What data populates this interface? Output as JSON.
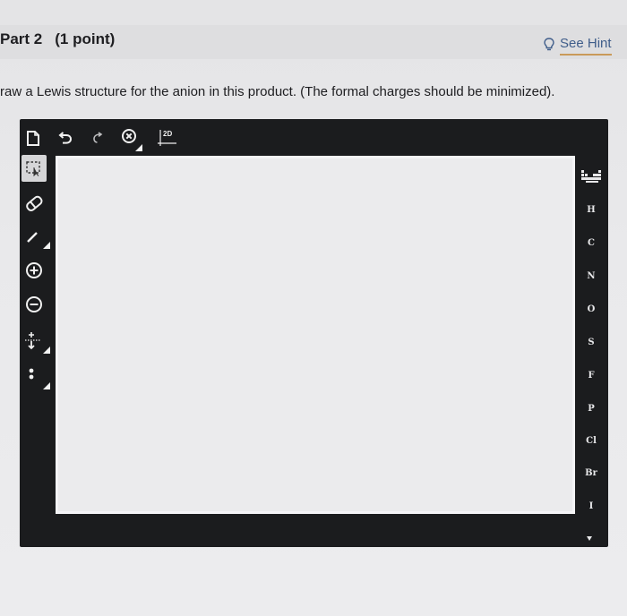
{
  "header": {
    "part_label": "Part 2",
    "points_label": "(1 point)",
    "hint_label": "See Hint"
  },
  "prompt": "raw a Lewis structure for the anion in this product. (The formal charges should be minimized).",
  "toolbar": {
    "top": [
      {
        "name": "new-document-icon"
      },
      {
        "name": "undo-icon"
      },
      {
        "name": "redo-icon"
      },
      {
        "name": "clear-icon"
      },
      {
        "name": "view-2d-button",
        "label": "2D"
      }
    ],
    "left": [
      {
        "name": "select-tool"
      },
      {
        "name": "eraser-tool"
      },
      {
        "name": "bond-tool"
      },
      {
        "name": "positive-charge-tool"
      },
      {
        "name": "negative-charge-tool"
      },
      {
        "name": "arrow-tool"
      },
      {
        "name": "lone-pair-tool"
      }
    ]
  },
  "elements": [
    "H",
    "C",
    "N",
    "O",
    "S",
    "F",
    "P",
    "Cl",
    "Br",
    "I"
  ],
  "colors": {
    "editor_bg": "#1b1c1e",
    "canvas_bg": "#ebebed",
    "hint_text": "#3f5d8a",
    "hint_underline": "#c99a5a"
  }
}
